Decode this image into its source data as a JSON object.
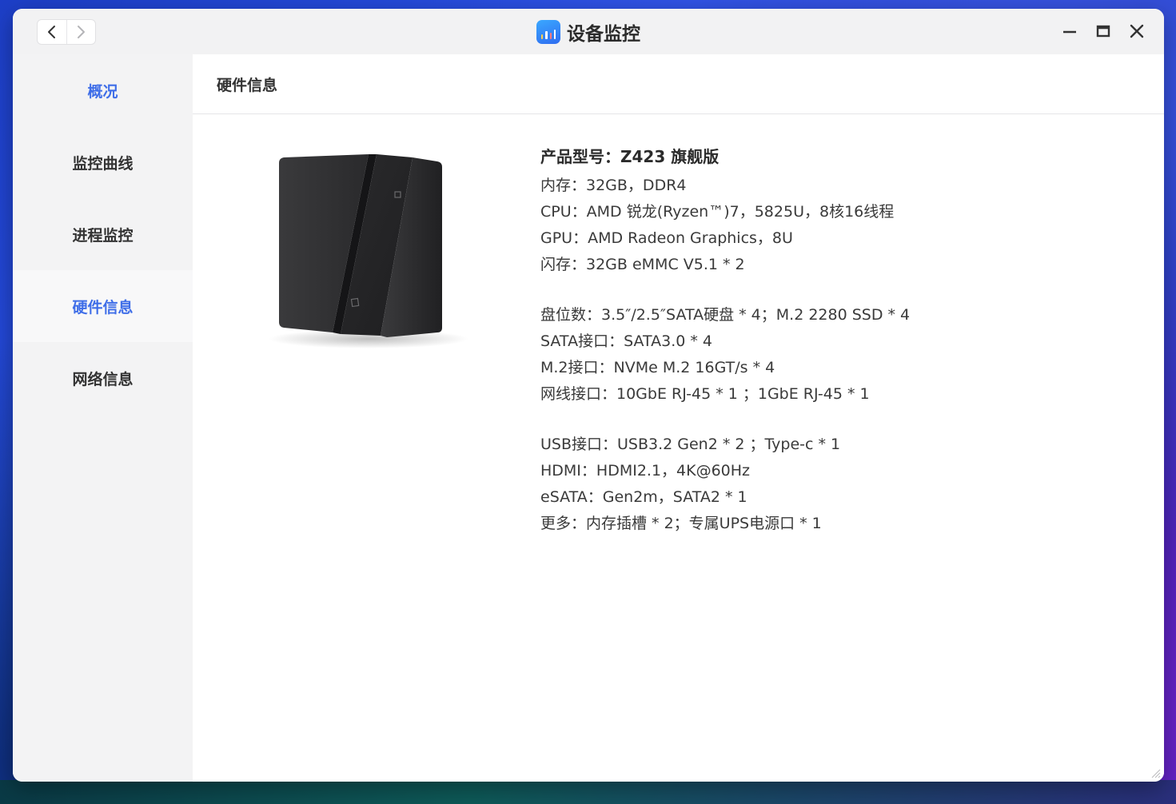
{
  "window": {
    "title": "设备监控",
    "nav_back": "back",
    "nav_forward": "forward"
  },
  "sidebar": {
    "items": [
      {
        "label": "概况"
      },
      {
        "label": "监控曲线"
      },
      {
        "label": "进程监控"
      },
      {
        "label": "硬件信息"
      },
      {
        "label": "网络信息"
      }
    ],
    "selected": "硬件信息"
  },
  "main": {
    "header": "硬件信息",
    "model": "产品型号：Z423 旗舰版",
    "groups": [
      [
        "内存：32GB，DDR4",
        "CPU：AMD 锐龙(Ryzen™)7，5825U，8核16线程",
        "GPU：AMD Radeon Graphics，8U",
        "闪存：32GB eMMC V5.1 * 2"
      ],
      [
        "盘位数：3.5″/2.5″SATA硬盘 * 4；M.2 2280 SSD * 4",
        "SATA接口：SATA3.0 * 4",
        "M.2接口：NVMe M.2 16GT/s * 4",
        "网线接口：10GbE RJ-45 * 1 ；1GbE RJ-45 * 1"
      ],
      [
        "USB接口：USB3.2 Gen2 * 2 ；Type-c * 1",
        "HDMI：HDMI2.1，4K@60Hz",
        "eSATA：Gen2m，SATA2 * 1",
        "更多：内存插槽 * 2；专属UPS电源口 * 1"
      ]
    ]
  },
  "colors": {
    "accent": "#3f6ee8",
    "sidebar_bg": "#f3f3f4",
    "titlebar_bg": "#f2f2f3"
  },
  "icons": {
    "app": "monitor-chart-icon",
    "back": "chevron-left-icon",
    "forward": "chevron-right-icon",
    "minimize": "minimize-icon",
    "maximize": "maximize-icon",
    "close": "close-icon",
    "resize": "resize-grip-icon"
  }
}
